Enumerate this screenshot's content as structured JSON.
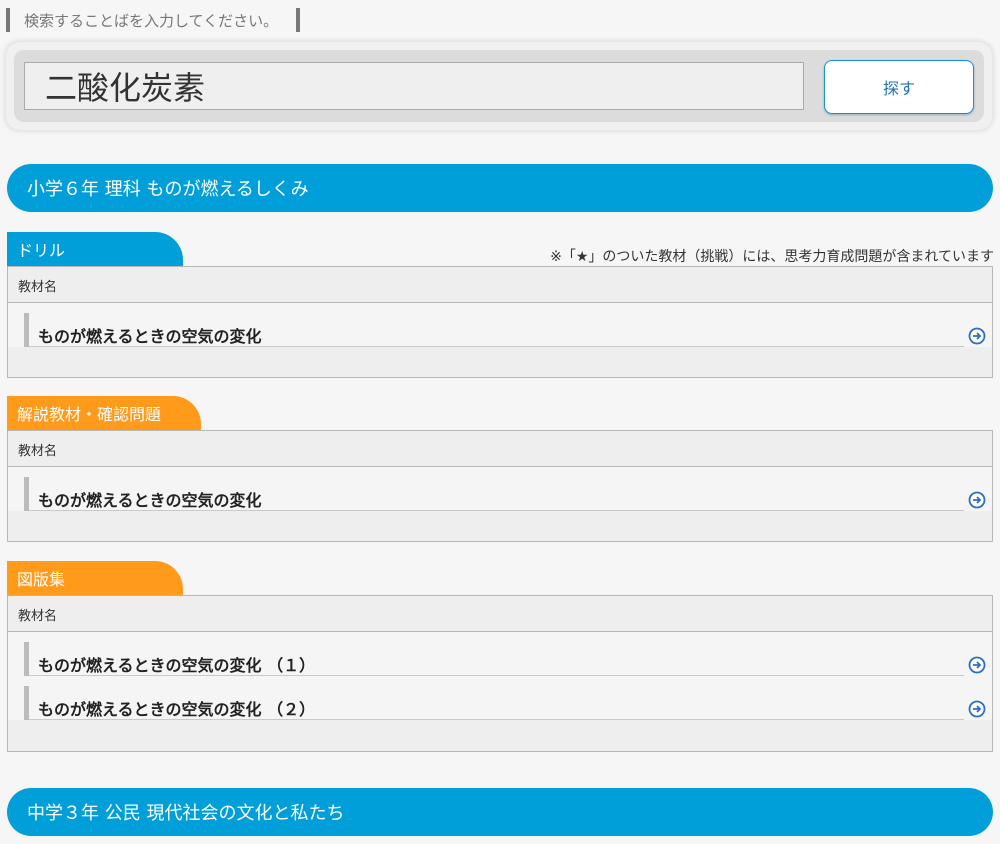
{
  "search": {
    "label": "検索することばを入力してください。",
    "value": "二酸化炭素",
    "button": "探す"
  },
  "groups": [
    {
      "heading": "小学６年 理科 ものが燃えるしくみ",
      "note": "※「★」のついた教材（挑戦）には、思考力育成問題が含まれています",
      "sections": [
        {
          "tab": "ドリル",
          "column": "教材名",
          "items": [
            "ものが燃えるときの空気の変化"
          ]
        },
        {
          "tab": "解説教材・確認問題",
          "column": "教材名",
          "items": [
            "ものが燃えるときの空気の変化"
          ]
        },
        {
          "tab": "図版集",
          "column": "教材名",
          "items": [
            "ものが燃えるときの空気の変化 （１）",
            "ものが燃えるときの空気の変化 （２）"
          ]
        }
      ]
    },
    {
      "heading": "中学３年 公民 現代社会の文化と私たち"
    }
  ],
  "icons": {
    "open": "arrow-circle-right-icon"
  },
  "colors": {
    "blue": "#009fd9",
    "orange": "#ff9a1a"
  }
}
